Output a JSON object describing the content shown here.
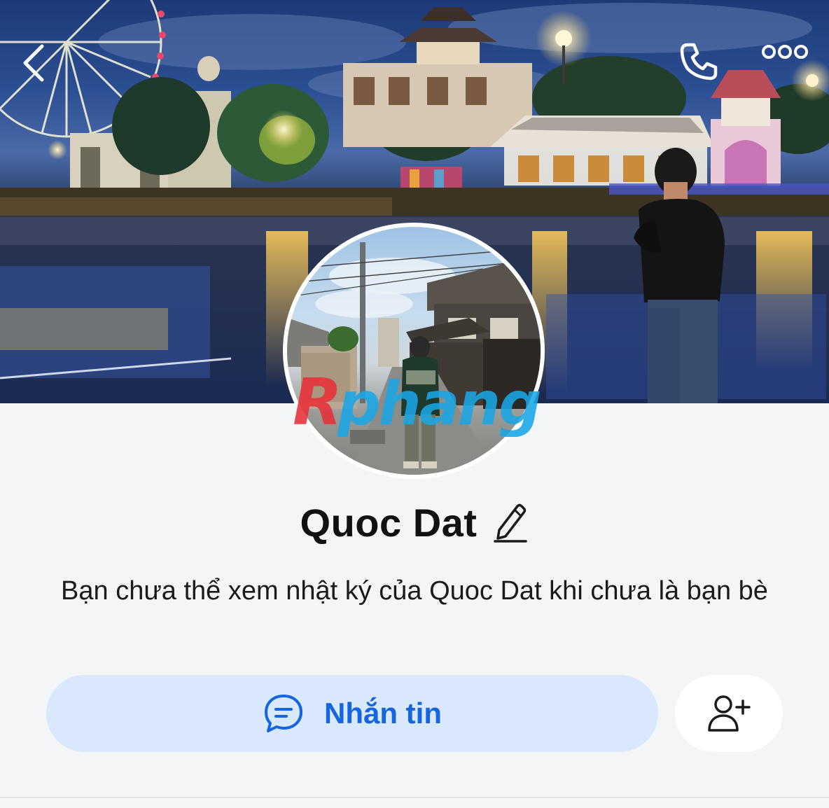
{
  "header": {
    "back_icon": "chevron-left-icon",
    "call_icon": "phone-icon",
    "more_icon": "more-dots-icon"
  },
  "cover_photo": {
    "description_icon": "cover-photo"
  },
  "avatar": {
    "icon": "avatar"
  },
  "watermark": {
    "text": "Rphang",
    "colors": [
      "#e8303a",
      "#1aa7e6"
    ]
  },
  "profile": {
    "name": "Quoc Dat",
    "edit_icon": "pencil-icon",
    "diary_note": "Bạn chưa thể xem nhật ký của Quoc Dat khi chưa là bạn bè"
  },
  "actions": {
    "message_label": "Nhắn tin",
    "message_icon": "chat-bubble-icon",
    "add_friend_icon": "add-friend-icon"
  },
  "colors": {
    "accent": "#1565e0",
    "message_bg": "#d9e8fc",
    "page_bg": "#f3f5f7"
  }
}
